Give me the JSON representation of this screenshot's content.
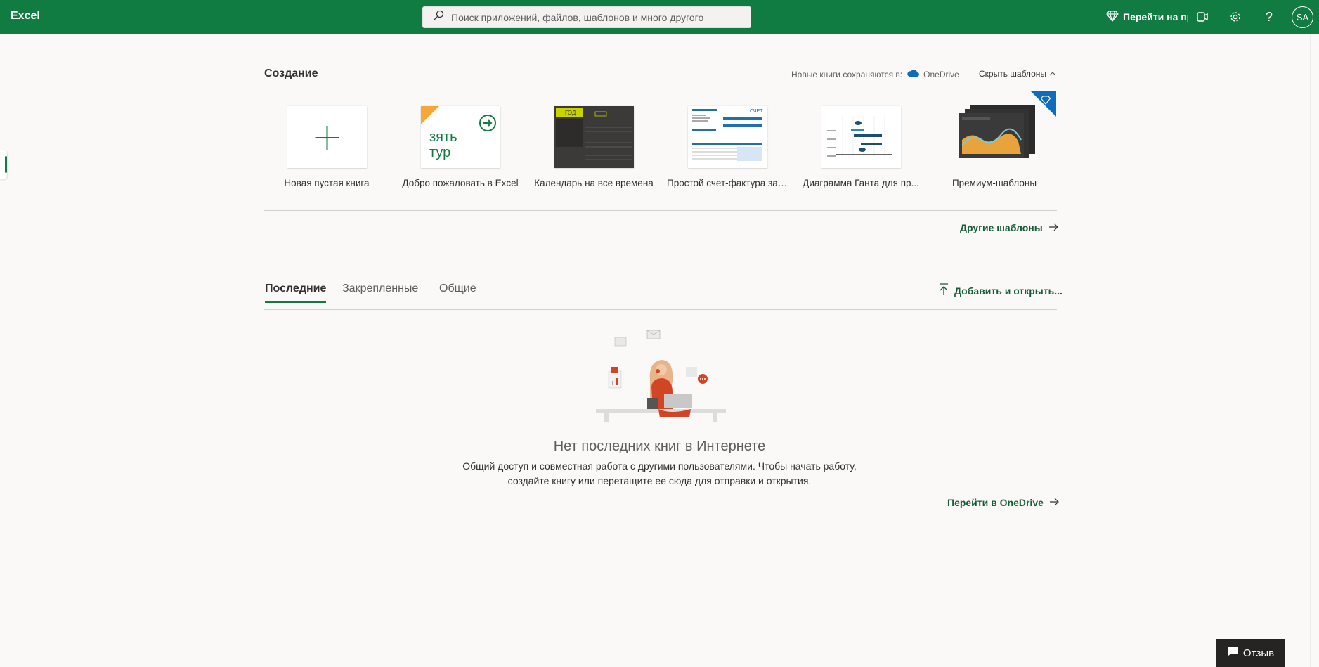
{
  "app": {
    "title": "Excel"
  },
  "search": {
    "placeholder": "Поиск приложений, файлов, шаблонов и много другого"
  },
  "topbar": {
    "premium_label": "Перейти на премиум",
    "avatar_initials": "SA"
  },
  "create": {
    "title": "Создание",
    "save_note": "Новые книги сохраняются в:",
    "save_location": "OneDrive",
    "hide_templates": "Скрыть шаблоны",
    "templates": [
      {
        "label": "Новая пустая книга"
      },
      {
        "label": "Добро пожаловать в Excel",
        "thumb_text": "зять\nтур"
      },
      {
        "label": "Календарь на все времена",
        "thumb_text": "ГОД"
      },
      {
        "label": "Простой счет-фактура за ...",
        "thumb_text": "СЧЕТ"
      },
      {
        "label": "Диаграмма Ганта для пр..."
      },
      {
        "label": "Премиум-шаблоны"
      }
    ],
    "more_templates": "Другие шаблоны"
  },
  "recent": {
    "tabs": [
      "Последние",
      "Закрепленные",
      "Общие"
    ],
    "active_tab": "Последние",
    "add_open": "Добавить и открыть...",
    "empty_title": "Нет последних книг в Интернете",
    "empty_desc_line1": "Общий доступ и совместная работа с другими пользователями. Чтобы начать работу,",
    "empty_desc_line2": "создайте книгу или перетащите ее сюда для отправки и открытия.",
    "go_onedrive": "Перейти в OneDrive"
  },
  "feedback": {
    "label": "Отзыв"
  },
  "colors": {
    "brand": "#107c41",
    "link": "#185c37",
    "premium": "#0f6cbd"
  }
}
